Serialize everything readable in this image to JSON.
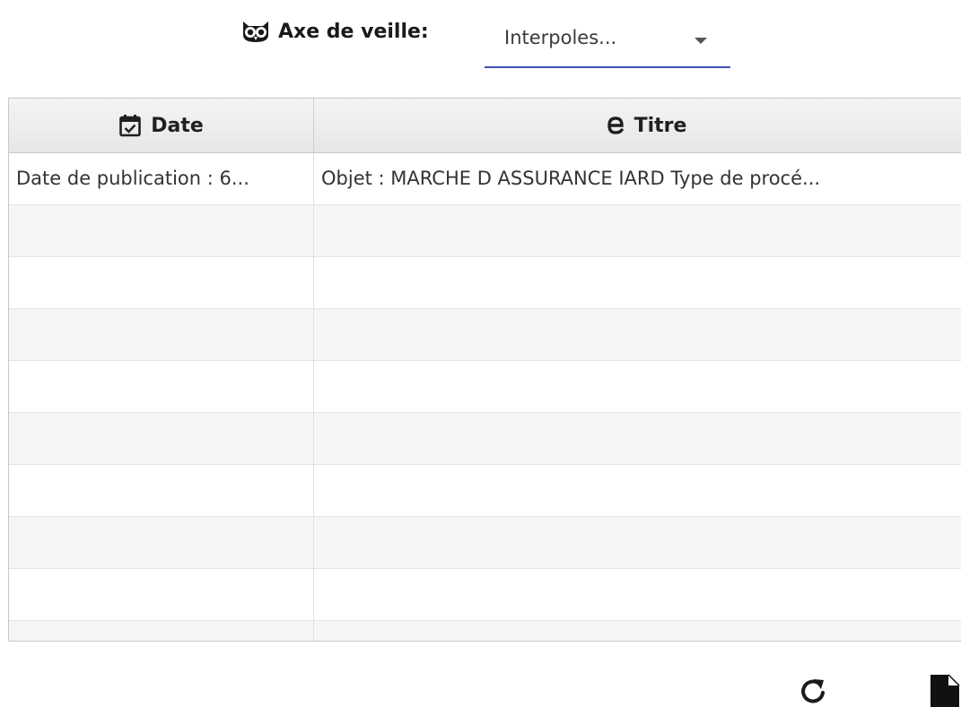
{
  "filter": {
    "icon": "owl-icon",
    "label": "Axe de veille:",
    "selected_value": "Interpoles...",
    "accent_color": "#3f51b5"
  },
  "table": {
    "columns": [
      {
        "icon": "calendar-check-icon",
        "label": "Date"
      },
      {
        "icon": "edge-e-icon",
        "label": "Titre"
      }
    ],
    "rows": [
      {
        "date": "Date de publication : 6...",
        "titre": "Objet : MARCHE D ASSURANCE IARD Type de procé..."
      },
      {
        "date": "",
        "titre": ""
      },
      {
        "date": "",
        "titre": ""
      },
      {
        "date": "",
        "titre": ""
      },
      {
        "date": "",
        "titre": ""
      },
      {
        "date": "",
        "titre": ""
      },
      {
        "date": "",
        "titre": ""
      },
      {
        "date": "",
        "titre": ""
      },
      {
        "date": "",
        "titre": ""
      },
      {
        "date": "",
        "titre": ""
      }
    ]
  },
  "toolbar": {
    "refresh_icon": "refresh-icon",
    "document_icon": "document-icon"
  }
}
